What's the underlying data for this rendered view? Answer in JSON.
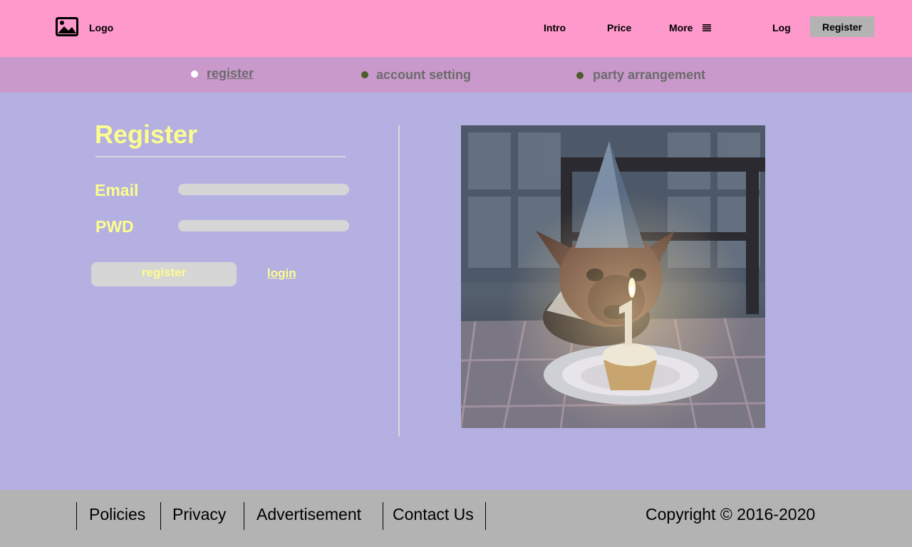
{
  "header": {
    "logo_label": "Logo",
    "nav": {
      "intro": "Intro",
      "price": "Price",
      "more": "More",
      "log": "Log",
      "register": "Register"
    },
    "more_icon": "menu-icon",
    "logo_icon": "image-icon",
    "bg_color": "#fd99cb"
  },
  "steps": [
    {
      "label": "register",
      "active": true
    },
    {
      "label": "account setting",
      "active": false
    },
    {
      "label": "party arrangement",
      "active": false
    }
  ],
  "form": {
    "title": "Register",
    "email_label": "Email",
    "email_value": "",
    "pwd_label": "PWD",
    "pwd_value": "",
    "submit_label": "register",
    "login_label": "login",
    "accent_color": "#fdfd8e"
  },
  "photo": {
    "subject": "dog in party hat with birthday cupcake and candle"
  },
  "footer": {
    "links": [
      "Policies",
      "Privacy",
      "Advertisement",
      "Contact Us"
    ],
    "copyright": "Copyright  © 2016-2020"
  }
}
